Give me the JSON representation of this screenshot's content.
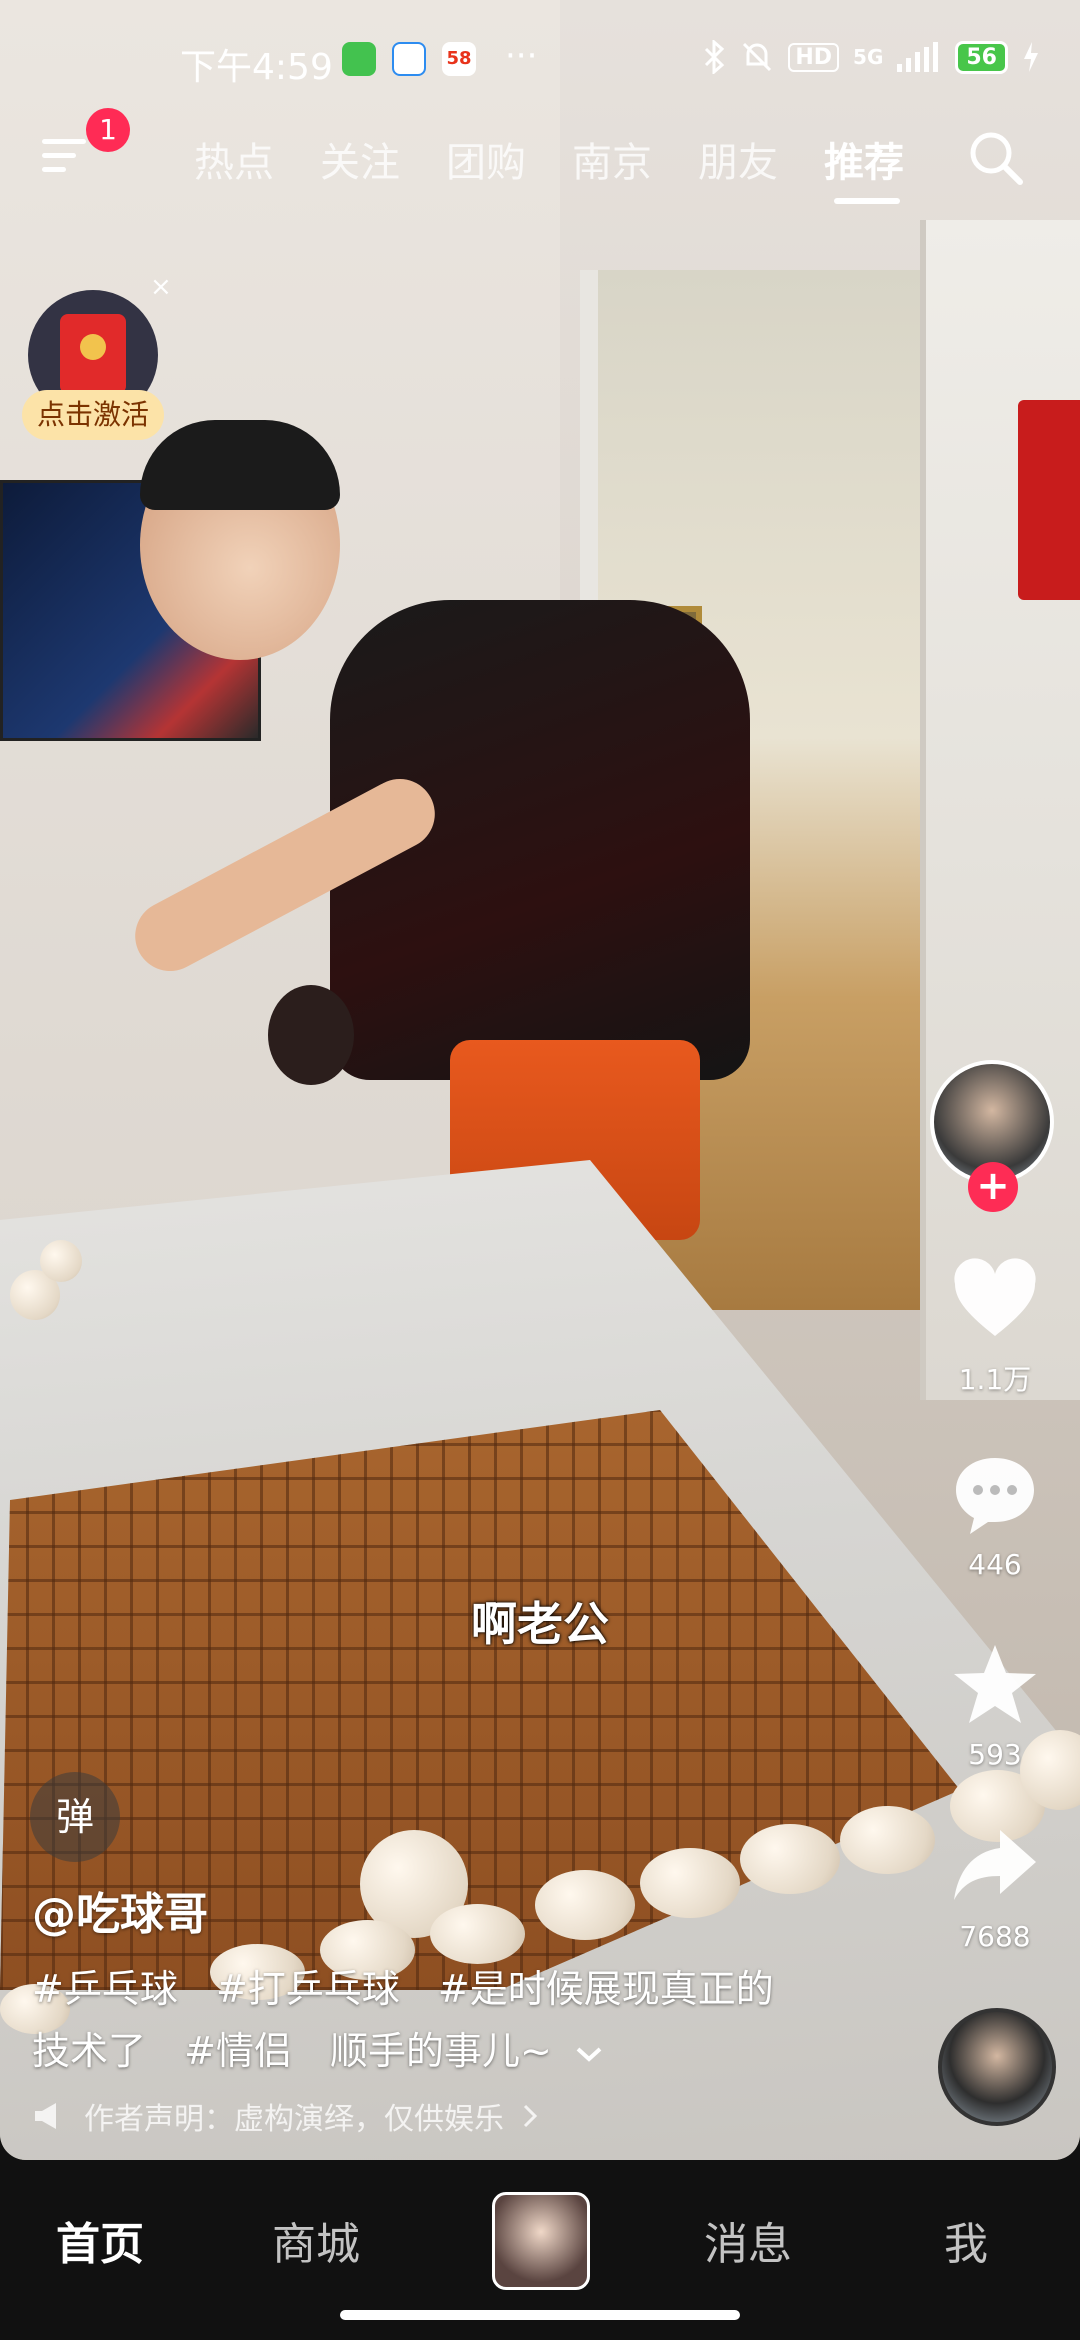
{
  "status_bar": {
    "time": "下午4:59",
    "notif_icons": [
      "wechat-icon",
      "app-icon",
      "58-app-icon"
    ],
    "notif_58_label": "58",
    "more": "···",
    "network": "5G",
    "hd": "HD",
    "battery": "56"
  },
  "top_nav": {
    "badge_count": "1",
    "tabs": [
      {
        "label": "热点"
      },
      {
        "label": "关注"
      },
      {
        "label": "团购"
      },
      {
        "label": "南京"
      },
      {
        "label": "朋友"
      },
      {
        "label": "推荐"
      }
    ],
    "active_tab": "推荐"
  },
  "red_packet": {
    "label": "点击激活",
    "close": "×"
  },
  "video": {
    "subtitle": "啊老公",
    "author": "@吃球哥",
    "hashtags_line1": [
      "#乒乓球",
      "#打乒乓球",
      "#是时候展现真正的"
    ],
    "line2_tags": [
      "技术了",
      "#情侣"
    ],
    "line2_text": "顺手的事儿~",
    "expand_icon": "chevron-down-icon",
    "disclaimer": "作者声明：虚构演绎，仅供娱乐",
    "danmu": "弹"
  },
  "actions": {
    "likes": "1.1万",
    "comments": "446",
    "favorites": "593",
    "shares": "7688",
    "follow": "+"
  },
  "bottom_nav": {
    "items": [
      "首页",
      "商城",
      "消息",
      "我"
    ],
    "active": "首页"
  }
}
